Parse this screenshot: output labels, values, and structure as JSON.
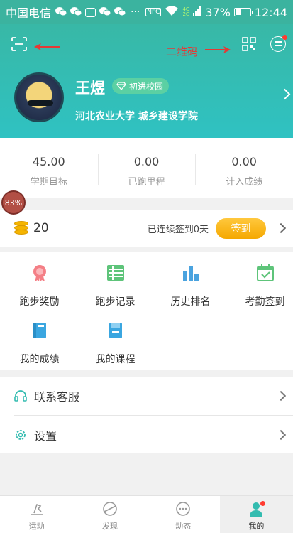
{
  "status_bar": {
    "carrier": "中国电信",
    "more": "···",
    "nfc": "NFC",
    "net_top": "4G",
    "net_bottom": "2G",
    "battery": "37%",
    "battery_level": 0.37,
    "time": "12:44"
  },
  "header": {
    "annotation": "二维码",
    "username": "王煜",
    "badge": "初进校园",
    "school": "河北农业大学 城乡建设学院"
  },
  "stats": [
    {
      "value": "45.00",
      "label": "学期目标"
    },
    {
      "value": "0.00",
      "label": "已跑里程"
    },
    {
      "value": "0.00",
      "label": "计入成绩"
    }
  ],
  "progress_bubble": "83%",
  "checkin": {
    "coins": "20",
    "streak": "已连续签到0天",
    "button": "签到"
  },
  "grid": [
    {
      "label": "跑步奖励",
      "icon": "medal-icon"
    },
    {
      "label": "跑步记录",
      "icon": "list-icon"
    },
    {
      "label": "历史排名",
      "icon": "bar-chart-icon"
    },
    {
      "label": "考勤签到",
      "icon": "calendar-check-icon"
    },
    {
      "label": "我的成绩",
      "icon": "notebook-icon"
    },
    {
      "label": "我的课程",
      "icon": "book-icon"
    }
  ],
  "menu": [
    {
      "label": "联系客服",
      "icon": "headset-icon"
    },
    {
      "label": "设置",
      "icon": "settings-gear-icon"
    }
  ],
  "tabs": [
    {
      "label": "运动",
      "icon": "run-icon",
      "active": false
    },
    {
      "label": "发现",
      "icon": "planet-icon",
      "active": false
    },
    {
      "label": "动态",
      "icon": "chat-bubble-icon",
      "active": false
    },
    {
      "label": "我的",
      "icon": "person-icon",
      "active": true
    }
  ],
  "colors": {
    "accent": "#33bcb0",
    "gold": "#f5b400",
    "badge": "#5bd0a3",
    "annotation": "#e53935"
  }
}
